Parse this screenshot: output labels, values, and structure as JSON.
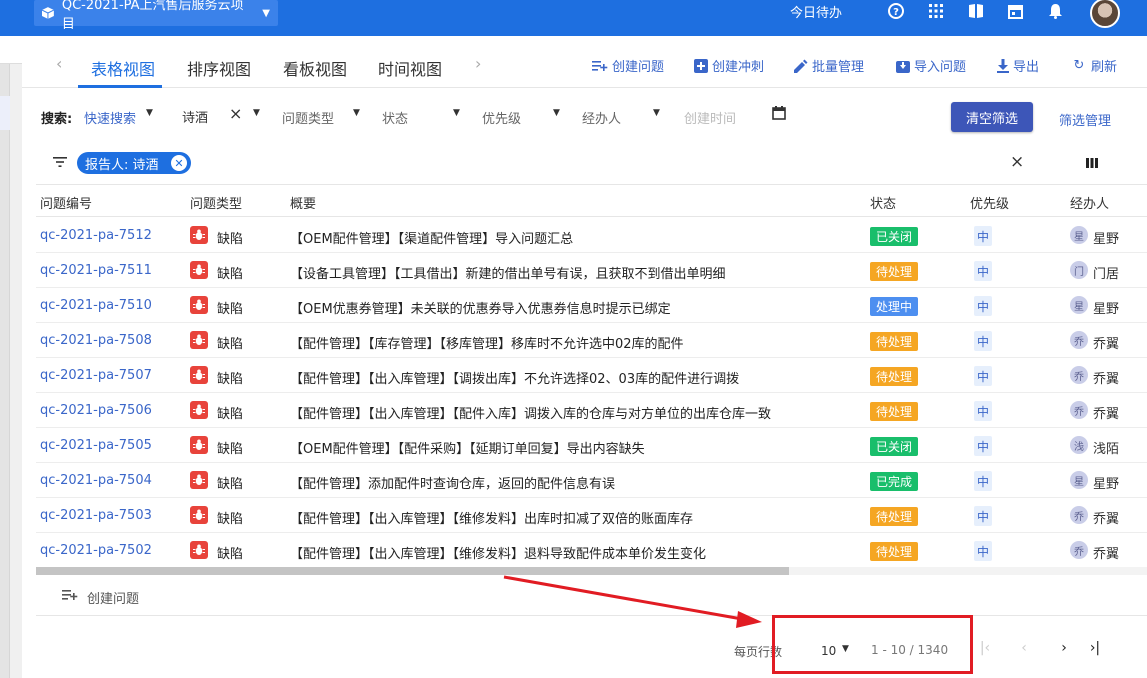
{
  "header": {
    "project": "QC-2021-PA上汽售后服务云项目",
    "today": "今日待办",
    "icons": [
      "help-icon",
      "apps-icon",
      "book-icon",
      "calendar-icon",
      "bell-icon"
    ],
    "brand_color": "#1e6fe0"
  },
  "tabs": {
    "items": [
      "表格视图",
      "排序视图",
      "看板视图",
      "时间视图"
    ],
    "active": "表格视图"
  },
  "actions": {
    "create_issue": "创建问题",
    "create_offset": "创建冲刺",
    "bulk_manage": "批量管理",
    "import_issue": "导入问题",
    "export": "导出",
    "refresh": "刷新"
  },
  "filters": {
    "search_label": "搜索:",
    "quick_search": "快速搜索",
    "reporter_value": "诗酒",
    "issue_type": "问题类型",
    "status": "状态",
    "priority": "优先级",
    "assignee": "经办人",
    "created_time_placeholder": "创建时间",
    "clear_button": "清空筛选",
    "manage_button": "筛选管理"
  },
  "active_filter_chip": "报告人: 诗酒",
  "table": {
    "columns": [
      "问题编号",
      "问题类型",
      "概要",
      "状态",
      "优先级",
      "经办人"
    ],
    "rows": [
      {
        "id": "qc-2021-pa-7512",
        "type": "缺陷",
        "summary": "【OEM配件管理】【渠道配件管理】导入问题汇总",
        "status": "已关闭",
        "status_color": "#19be6b",
        "priority": "中",
        "assignee_initial": "星",
        "assignee": "星野"
      },
      {
        "id": "qc-2021-pa-7511",
        "type": "缺陷",
        "summary": "【设备工具管理】【工具借出】新建的借出单号有误，且获取不到借出单明细",
        "status": "待处理",
        "status_color": "#f5a623",
        "priority": "中",
        "assignee_initial": "门",
        "assignee": "门居"
      },
      {
        "id": "qc-2021-pa-7510",
        "type": "缺陷",
        "summary": "【OEM优惠券管理】未关联的优惠券导入优惠券信息时提示已绑定",
        "status": "处理中",
        "status_color": "#4d8ff0",
        "priority": "中",
        "assignee_initial": "星",
        "assignee": "星野"
      },
      {
        "id": "qc-2021-pa-7508",
        "type": "缺陷",
        "summary": "【配件管理】【库存管理】【移库管理】移库时不允许选中02库的配件",
        "status": "待处理",
        "status_color": "#f5a623",
        "priority": "中",
        "assignee_initial": "乔",
        "assignee": "乔翼"
      },
      {
        "id": "qc-2021-pa-7507",
        "type": "缺陷",
        "summary": "【配件管理】【出入库管理】【调拨出库】不允许选择02、03库的配件进行调拨",
        "status": "待处理",
        "status_color": "#f5a623",
        "priority": "中",
        "assignee_initial": "乔",
        "assignee": "乔翼"
      },
      {
        "id": "qc-2021-pa-7506",
        "type": "缺陷",
        "summary": "【配件管理】【出入库管理】【配件入库】调拨入库的仓库与对方单位的出库仓库一致",
        "status": "待处理",
        "status_color": "#f5a623",
        "priority": "中",
        "assignee_initial": "乔",
        "assignee": "乔翼"
      },
      {
        "id": "qc-2021-pa-7505",
        "type": "缺陷",
        "summary": "【OEM配件管理】【配件采购】【延期订单回复】导出内容缺失",
        "status": "已关闭",
        "status_color": "#19be6b",
        "priority": "中",
        "assignee_initial": "浅",
        "assignee": "浅陌"
      },
      {
        "id": "qc-2021-pa-7504",
        "type": "缺陷",
        "summary": "【配件管理】添加配件时查询仓库，返回的配件信息有误",
        "status": "已完成",
        "status_color": "#19be6b",
        "priority": "中",
        "assignee_initial": "星",
        "assignee": "星野"
      },
      {
        "id": "qc-2021-pa-7503",
        "type": "缺陷",
        "summary": "【配件管理】【出入库管理】【维修发料】出库时扣减了双倍的账面库存",
        "status": "待处理",
        "status_color": "#f5a623",
        "priority": "中",
        "assignee_initial": "乔",
        "assignee": "乔翼"
      },
      {
        "id": "qc-2021-pa-7502",
        "type": "缺陷",
        "summary": "【配件管理】【出入库管理】【维修发料】退料导致配件成本单价发生变化",
        "status": "待处理",
        "status_color": "#f5a623",
        "priority": "中",
        "assignee_initial": "乔",
        "assignee": "乔翼"
      }
    ]
  },
  "footer": {
    "create_issue": "创建问题",
    "rows_per_page_label": "每页行数",
    "rows_per_page": "10",
    "range": "1 - 10 / 1340"
  },
  "annotation": {
    "color": "#e11c23"
  }
}
